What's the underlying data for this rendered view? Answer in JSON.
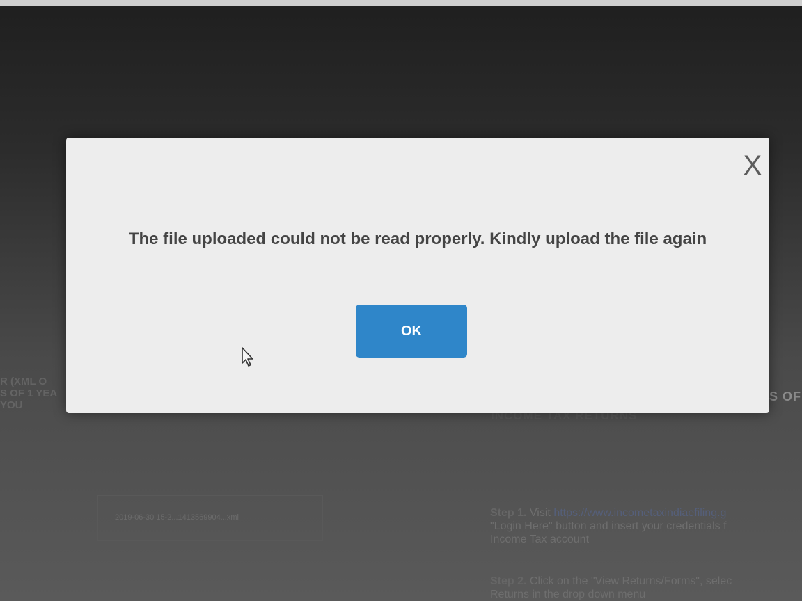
{
  "dialog": {
    "message": "The file uploaded could not be read properly. Kindly upload the file again",
    "ok_label": "OK",
    "close_label": "X",
    "ok_color": "#2f86c9"
  },
  "background": {
    "left_lines": [
      "R (XML O",
      "S OF 1 YEA",
      "YOU"
    ],
    "right_edge": "ES OF",
    "section_title": "INCOME TAX RETURNS",
    "file_name": "2019-06-30 15-2...1413569904...xml",
    "step1_label": "Step 1.",
    "step1_text": "Visit",
    "step1_link": "https://www.incometaxindiaefiling.g",
    "step1_line2": "\"Login Here\" button and insert your credentials f",
    "step1_line3": "Income Tax account",
    "step2_label": "Step 2.",
    "step2_text": "Click on the \"View Returns/Forms\", selec",
    "step2_line2": "Returns in the drop down menu"
  }
}
